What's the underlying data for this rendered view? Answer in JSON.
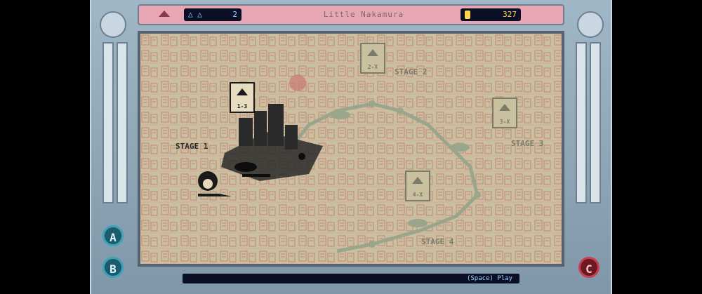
{
  "hud": {
    "lives": "2",
    "level_name": "Little Nakamura",
    "coins": "327"
  },
  "map": {
    "stages": [
      {
        "label": "STAGE 1",
        "active": true
      },
      {
        "label": "STAGE 2",
        "active": false
      },
      {
        "label": "STAGE 3",
        "active": false
      },
      {
        "label": "STAGE 4",
        "active": false
      }
    ],
    "level_nodes": [
      {
        "label": "1-3",
        "active": true
      },
      {
        "label": "2-X",
        "active": false
      },
      {
        "label": "3-X",
        "active": false
      },
      {
        "label": "4-X",
        "active": false
      }
    ]
  },
  "controls": {
    "a": "A",
    "b": "B",
    "c": "C",
    "hint": "(Space) Play"
  },
  "colors": {
    "map_bg": "#c9c0a0",
    "map_lines": "#c97b74",
    "path": "#9aa68c",
    "hud_panel": "#0a0f26",
    "coin": "#ffd54a"
  }
}
